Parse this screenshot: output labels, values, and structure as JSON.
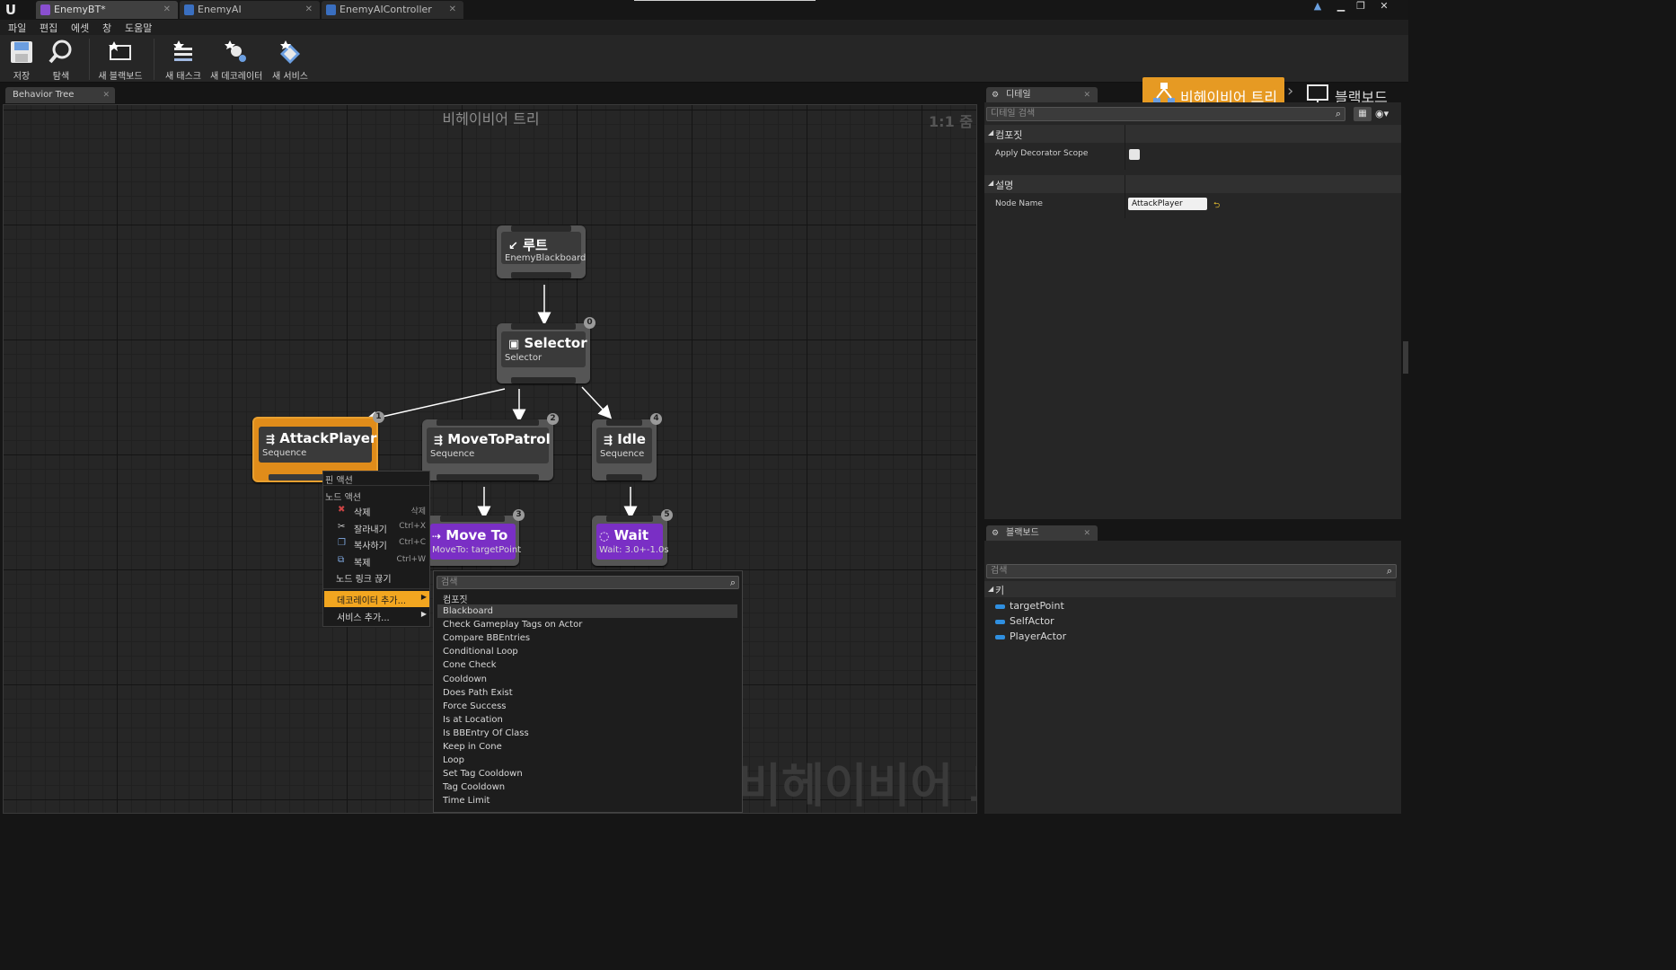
{
  "tabs": [
    {
      "label": "EnemyBT*",
      "color": "#8a4fd0",
      "active": true
    },
    {
      "label": "EnemyAI",
      "color": "#3a6fc0",
      "active": false
    },
    {
      "label": "EnemyAIController",
      "color": "#3a6fc0",
      "active": false
    }
  ],
  "menu": [
    "파일",
    "편집",
    "에셋",
    "창",
    "도움말"
  ],
  "toolbar": {
    "save": "저장",
    "browse": "탐색",
    "new_blackboard": "새 블랙보드",
    "new_task": "새 태스크",
    "new_decorator": "새 데코레이터",
    "new_service": "새 서비스"
  },
  "modes": {
    "behavior_tree": "비헤이비어 트리",
    "blackboard": "블랙보드"
  },
  "graph_tab": "Behavior Tree",
  "graph": {
    "title": "비헤이비어 트리",
    "zoom": "1:1 줌",
    "watermark": "비헤이비어 트리"
  },
  "nodes": {
    "root": {
      "title": "루트",
      "sub": "EnemyBlackboard"
    },
    "selector": {
      "title": "Selector",
      "sub": "Selector",
      "index": "0"
    },
    "attack": {
      "title": "AttackPlayer",
      "sub": "Sequence",
      "index": "1"
    },
    "patrol": {
      "title": "MoveToPatrol",
      "sub": "Sequence",
      "index": "2"
    },
    "idle": {
      "title": "Idle",
      "sub": "Sequence",
      "index": "4"
    },
    "moveto": {
      "title": "Move To",
      "sub": "MoveTo: targetPoint",
      "index": "3"
    },
    "wait": {
      "title": "Wait",
      "sub": "Wait: 3.0+-1.0s",
      "index": "5"
    }
  },
  "context_menu": {
    "pin_actions": "핀 액션",
    "node_actions": "노드 액션",
    "delete": "삭제",
    "delete_sc": "삭제",
    "cut": "잘라내기",
    "cut_sc": "Ctrl+X",
    "copy": "복사하기",
    "copy_sc": "Ctrl+C",
    "duplicate": "복제",
    "duplicate_sc": "Ctrl+W",
    "break_links": "노드 링크 끊기",
    "add_decorator": "데코레이터 추가...",
    "add_service": "서비스 추가..."
  },
  "decorator_menu": {
    "search_placeholder": "검색",
    "category": "컴포짓",
    "options": [
      "Blackboard",
      "Check Gameplay Tags on Actor",
      "Compare BBEntries",
      "Conditional Loop",
      "Cone Check",
      "Cooldown",
      "Does Path Exist",
      "Force Success",
      "Is at Location",
      "Is BBEntry Of Class",
      "Keep in Cone",
      "Loop",
      "Set Tag Cooldown",
      "Tag Cooldown",
      "Time Limit"
    ]
  },
  "details": {
    "tab": "디테일",
    "search_placeholder": "디테일 검색",
    "composite": "컴포짓",
    "apply_decorator_scope": "Apply Decorator Scope",
    "description": "설명",
    "node_name_label": "Node Name",
    "node_name_value": "AttackPlayer"
  },
  "blackboard": {
    "tab": "블랙보드",
    "search_placeholder": "검색",
    "keys_header": "키",
    "keys": [
      "targetPoint",
      "SelfActor",
      "PlayerActor"
    ]
  }
}
